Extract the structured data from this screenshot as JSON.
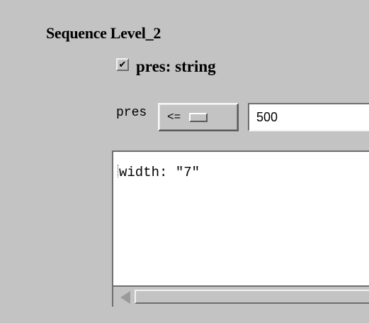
{
  "section": {
    "title": "Sequence Level_2"
  },
  "variable": {
    "checked": true,
    "check_mark": "✔",
    "label": "pres: string"
  },
  "constraint": {
    "field_name": "pres",
    "operator": "<=",
    "value": "500"
  },
  "output": {
    "text": "width: \"7\""
  }
}
